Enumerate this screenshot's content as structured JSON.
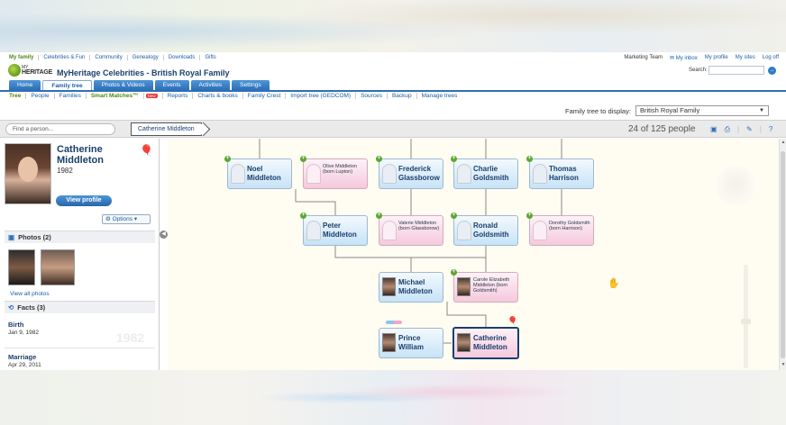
{
  "toplinks": [
    "My family",
    "Celebrities & Fun",
    "Community",
    "Genealogy",
    "Downloads",
    "Gifts"
  ],
  "rightlinks": [
    "Marketing Team",
    "My inbox",
    "My profile",
    "My sites",
    "Log off"
  ],
  "logo": {
    "my": "MY",
    "heritage": "HERITAGE"
  },
  "site_title": "MyHeritage Celebrities - British Royal Family",
  "search": {
    "label": "Search:",
    "go": "→"
  },
  "main_tabs": [
    "Home",
    "Family tree",
    "Photos & Videos",
    "Events",
    "Activities",
    "Settings"
  ],
  "sub_nav": [
    "Tree",
    "People",
    "Families",
    "Smart Matches™",
    "Reports",
    "Charts & books",
    "Family Crest",
    "Import tree (GEDCOM)",
    "Sources",
    "Backup",
    "Manage trees"
  ],
  "new_badge": "New",
  "display": {
    "label": "Family tree to display:",
    "value": "British Royal Family",
    "arrow": "▼"
  },
  "toolbar": {
    "find_placeholder": "Find a person...",
    "crumb": "Catherine Middleton",
    "count": "24 of 125 people",
    "icons": [
      "▣",
      "⎙",
      "|",
      "✎",
      "|",
      "?"
    ]
  },
  "profile": {
    "name": "Catherine Middleton",
    "year": "1982",
    "view_profile": "View profile",
    "options": "⚙ Options ▾",
    "photos_head": "Photos (2)",
    "view_all": "View all photos",
    "facts_head": "Facts (3)",
    "facts": [
      {
        "label": "Birth",
        "value": "Jan 9, 1982"
      },
      {
        "label": "Marriage",
        "value": "Apr 29, 2011"
      }
    ],
    "facts_bg_year": "1982",
    "collapse": "◀"
  },
  "tree": {
    "noel": "Noel Middleton",
    "olive": "Olive Middleton (born Lupton)",
    "frederick": "Frederick Glassborow",
    "charlie": "Charlie Goldsmith",
    "thomas": "Thomas Harrison",
    "peter": "Peter Middleton",
    "valerie": "Valerie Middleton (born Glassborow)",
    "ronald": "Ronald Goldsmith",
    "dorothy": "Dorothy Goldsmith (born Harrison)",
    "michael": "Michael Middleton",
    "carole": "Carole Elizabeth Middleton (born Goldsmith)",
    "william": "Prince William",
    "catherine": "Catherine Middleton",
    "plus": "+",
    "hand": "✋",
    "balloon": "🎈"
  },
  "scroll": {
    "up": "▲",
    "down": "▼"
  }
}
